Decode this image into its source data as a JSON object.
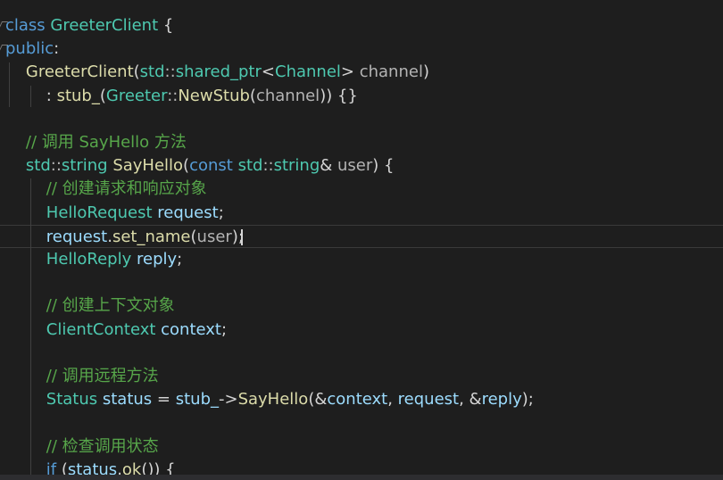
{
  "editor": {
    "lines": [
      [
        [
          "k",
          "class "
        ],
        [
          "t",
          "GreeterClient"
        ],
        [
          "p",
          " {"
        ]
      ],
      [
        [
          "k",
          "public"
        ],
        [
          "p",
          ":"
        ]
      ],
      [
        [
          "p",
          "    "
        ],
        [
          "f",
          "GreeterClient"
        ],
        [
          "p",
          "("
        ],
        [
          "t",
          "std"
        ],
        [
          "g",
          "::"
        ],
        [
          "t",
          "shared_ptr"
        ],
        [
          "p",
          "<"
        ],
        [
          "t",
          "Channel"
        ],
        [
          "p",
          "> "
        ],
        [
          "g",
          "channel"
        ],
        [
          "p",
          ")"
        ]
      ],
      [
        [
          "p",
          "        : "
        ],
        [
          "f",
          "stub_"
        ],
        [
          "p",
          "("
        ],
        [
          "t",
          "Greeter"
        ],
        [
          "g",
          "::"
        ],
        [
          "f",
          "NewStub"
        ],
        [
          "p",
          "("
        ],
        [
          "g",
          "channel"
        ],
        [
          "p",
          ")) {}"
        ]
      ],
      [],
      [
        [
          "p",
          "    "
        ],
        [
          "c",
          "// 调用 SayHello 方法"
        ]
      ],
      [
        [
          "p",
          "    "
        ],
        [
          "t",
          "std"
        ],
        [
          "g",
          "::"
        ],
        [
          "t",
          "string "
        ],
        [
          "f",
          "SayHello"
        ],
        [
          "p",
          "("
        ],
        [
          "k",
          "const "
        ],
        [
          "t",
          "std"
        ],
        [
          "g",
          "::"
        ],
        [
          "t",
          "string"
        ],
        [
          "p",
          "& "
        ],
        [
          "g",
          "user"
        ],
        [
          "p",
          ") {"
        ]
      ],
      [
        [
          "p",
          "        "
        ],
        [
          "c",
          "// 创建请求和响应对象"
        ]
      ],
      [
        [
          "p",
          "        "
        ],
        [
          "t",
          "HelloRequest "
        ],
        [
          "v",
          "request"
        ],
        [
          "p",
          ";"
        ]
      ],
      [
        [
          "p",
          "        "
        ],
        [
          "v",
          "request"
        ],
        [
          "p",
          "."
        ],
        [
          "f",
          "set_name"
        ],
        [
          "p",
          "("
        ],
        [
          "g",
          "user"
        ],
        [
          "p",
          ");"
        ]
      ],
      [
        [
          "p",
          "        "
        ],
        [
          "t",
          "HelloReply "
        ],
        [
          "v",
          "reply"
        ],
        [
          "p",
          ";"
        ]
      ],
      [],
      [
        [
          "p",
          "        "
        ],
        [
          "c",
          "// 创建上下文对象"
        ]
      ],
      [
        [
          "p",
          "        "
        ],
        [
          "t",
          "ClientContext "
        ],
        [
          "v",
          "context"
        ],
        [
          "p",
          ";"
        ]
      ],
      [],
      [
        [
          "p",
          "        "
        ],
        [
          "c",
          "// 调用远程方法"
        ]
      ],
      [
        [
          "p",
          "        "
        ],
        [
          "t",
          "Status "
        ],
        [
          "v",
          "status"
        ],
        [
          "p",
          " = "
        ],
        [
          "v",
          "stub_"
        ],
        [
          "p",
          "->"
        ],
        [
          "f",
          "SayHello"
        ],
        [
          "p",
          "(&"
        ],
        [
          "v",
          "context"
        ],
        [
          "p",
          ", "
        ],
        [
          "v",
          "request"
        ],
        [
          "p",
          ", &"
        ],
        [
          "v",
          "reply"
        ],
        [
          "p",
          ");"
        ]
      ],
      [],
      [
        [
          "p",
          "        "
        ],
        [
          "c",
          "// 检查调用状态"
        ]
      ],
      [
        [
          "p",
          "        "
        ],
        [
          "k",
          "if "
        ],
        [
          "p",
          "("
        ],
        [
          "v",
          "status"
        ],
        [
          "p",
          "."
        ],
        [
          "f",
          "ok"
        ],
        [
          "p",
          "()) {"
        ]
      ]
    ],
    "current_line": 9
  },
  "colors": {
    "background": "#1e1e1e",
    "keyword": "#569cd6",
    "type": "#4ec9b0",
    "function": "#dcdcaa",
    "variable": "#9cdcfe",
    "comment": "#57a64a",
    "punctuation": "#d4d4d4"
  }
}
